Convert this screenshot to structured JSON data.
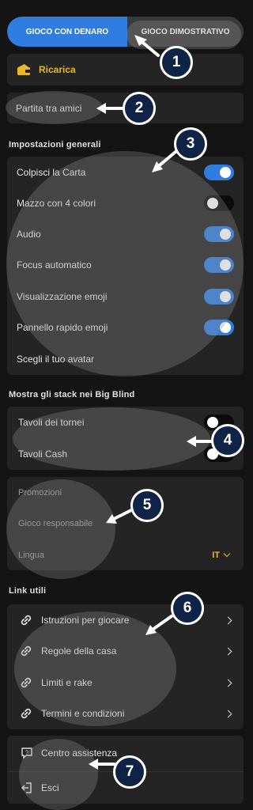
{
  "mode_tabs": {
    "real": "GIOCO CON DENARO",
    "demo": "GIOCO DIMOSTRATIVO"
  },
  "recharge": {
    "label": "Ricarica"
  },
  "friends_game": {
    "label": "Partita tra amici"
  },
  "general_settings": {
    "title": "Impostazioni generali",
    "items": [
      {
        "label": "Colpisci la Carta",
        "toggle": true
      },
      {
        "label": "Mazzo con 4 colori",
        "toggle": false
      },
      {
        "label": "Audio",
        "toggle": true
      },
      {
        "label": "Focus automatico",
        "toggle": true
      },
      {
        "label": "Visualizzazione emoji",
        "toggle": true
      },
      {
        "label": "Pannello rapido emoji",
        "toggle": true
      },
      {
        "label": "Scegli il tuo avatar"
      }
    ]
  },
  "big_blind": {
    "title": "Mostra gli stack nei Big Blind",
    "items": [
      {
        "label": "Tavoli dei tornei"
      },
      {
        "label": "Tavoli Cash"
      }
    ]
  },
  "misc": {
    "promotions": "Promozioni",
    "responsible": "Gioco responsabile",
    "language_label": "Lingua",
    "language_value": "IT"
  },
  "useful_links": {
    "title": "Link utili",
    "items": [
      {
        "label": "Istruzioni per giocare"
      },
      {
        "label": "Regole della casa"
      },
      {
        "label": "Limiti e rake"
      },
      {
        "label": "Termini e condizioni"
      }
    ]
  },
  "bottom": {
    "support": "Centro assistenza",
    "exit": "Esci"
  },
  "callouts": [
    "1",
    "2",
    "3",
    "4",
    "5",
    "6",
    "7"
  ],
  "colors": {
    "accent": "#2f7de1",
    "gold": "#e8b923",
    "badge": "#0f2346"
  }
}
